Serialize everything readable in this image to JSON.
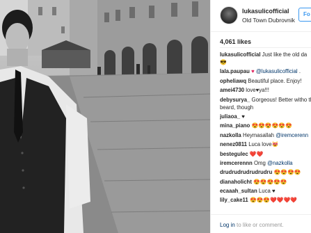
{
  "post": {
    "username": "lukasulicofficial",
    "location": "Old Town Dubrovnik",
    "follow_label": "Fo",
    "likes": "4,061 likes"
  },
  "comments": [
    {
      "user": "lukasulicofficial",
      "text": "Just like the old da",
      "extra": "😎"
    },
    {
      "user": "lala.paupau",
      "text": "♥",
      "mention": "@lukasulicofficial",
      "tail": "."
    },
    {
      "user": "opheliawq",
      "text": "Beautiful place. Enjoy!"
    },
    {
      "user": "amei4730",
      "text": "love♥ya!!!"
    },
    {
      "user": "debysurya_",
      "text": "Gorgeous! Better witho the beard, though"
    },
    {
      "user": "juliaoa_",
      "text": "♥"
    },
    {
      "user": "mina_piano",
      "text": "😍😍😍😍😍😍"
    },
    {
      "user": "nazkolla",
      "text": "Heymasallah",
      "mention": "@iremcerenn"
    },
    {
      "user": "nenez0811",
      "text": "Luca love😻"
    },
    {
      "user": "bestegulec",
      "text": "❤️❤️"
    },
    {
      "user": "iremcerennn",
      "text": "Omg",
      "mention": "@nazkolla"
    },
    {
      "user": "drudrudrudrudrudru",
      "text": "😍😍😍😍"
    },
    {
      "user": "dianaholicht",
      "text": "😍😍😍😍😍"
    },
    {
      "user": "ecaaah_sultan",
      "text": "Luca ♥"
    },
    {
      "user": "lily_cake11",
      "text": "😍😍😍❤️❤️❤️❤️"
    }
  ],
  "footer": {
    "login_link": "Log in",
    "login_rest": "to like or comment."
  },
  "icons": {
    "avatar": "profile-photo"
  }
}
